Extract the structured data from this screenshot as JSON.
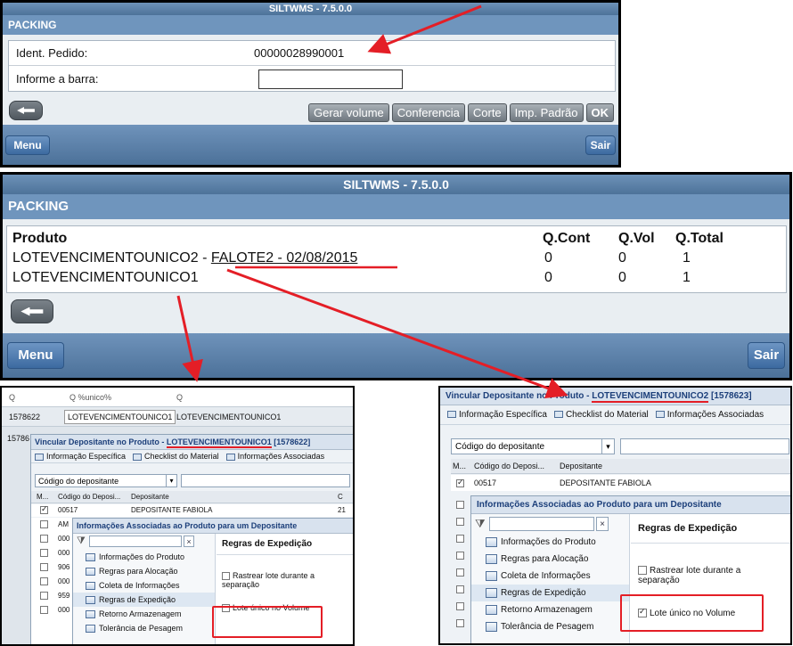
{
  "top": {
    "title": "SILTWMS - 7.5.0.0",
    "section": "PACKING",
    "rows": [
      {
        "label": "Ident. Pedido:",
        "value": "00000028990001"
      },
      {
        "label": "Informe a barra:",
        "value": ""
      }
    ],
    "buttons": [
      "Gerar volume",
      "Conferencia",
      "Corte",
      "Imp. Padrão",
      "OK"
    ],
    "menu": "Menu",
    "sair": "Sair"
  },
  "mid": {
    "title": "SILTWMS - 7.5.0.0",
    "section": "PACKING",
    "columns": [
      "Produto",
      "Q.Cont",
      "Q.Vol",
      "Q.Total"
    ],
    "rows": [
      {
        "produto_a": "LOTEVENCIMENTOUNICO2 - ",
        "produto_b": "FALOTE2 - 02/08/2015",
        "cont": "0",
        "vol": "0",
        "total": "1"
      },
      {
        "produto_a": "LOTEVENCIMENTOUNICO1",
        "produto_b": "",
        "cont": "0",
        "vol": "0",
        "total": "1"
      }
    ],
    "menu": "Menu",
    "sair": "Sair"
  },
  "left": {
    "filter": [
      "Q",
      "Q %unico%",
      "Q"
    ],
    "row1": [
      "1578622",
      "LOTEVENCIMENTOUNICO1",
      "LOTEVENCIMENTOUNICO1"
    ],
    "row2_id": "15786",
    "dialog_title_a": "Vincular Depositante no Produto - ",
    "dialog_title_b": "LOTEVENCIMENTOUNICO1",
    "dialog_title_c": " [1578622]",
    "tabs": [
      "Informação Específica",
      "Checklist do Material",
      "Informações Associadas"
    ],
    "select": "Código do depositante",
    "cols": [
      "M...",
      "Código do Deposi...",
      "Depositante",
      "C"
    ],
    "first_row": [
      "00517",
      "DEPOSITANTE FABIOLA",
      "21"
    ],
    "left_codes": [
      "AM",
      "000",
      "000",
      "906",
      "000",
      "959",
      "000"
    ],
    "inner_title": "Informações Associadas ao Produto para um Depositante",
    "tree": [
      "Informações do Produto",
      "Regras para Alocação",
      "Coleta de Informações",
      "Regras de Expedição",
      "Retorno Armazenagem",
      "Tolerância de Pesagem"
    ],
    "right_title": "Regras de Expedição",
    "opt1": "Rastrear lote durante a separação",
    "opt2": "Lote único no Volume"
  },
  "right": {
    "dialog_title_a": "Vincular Depositante no Produto - ",
    "dialog_title_b": "LOTEVENCIMENTOUNICO2",
    "dialog_title_c": " [1578623]",
    "tabs": [
      "Informação Específica",
      "Checklist do Material",
      "Informações Associadas"
    ],
    "select": "Código do depositante",
    "cols": [
      "M...",
      "Código do Deposi...",
      "Depositante"
    ],
    "first_row": [
      "00517",
      "DEPOSITANTE FABIOLA"
    ],
    "inner_title": "Informações Associadas ao Produto para um Depositante",
    "tree": [
      "Informações do Produto",
      "Regras para Alocação",
      "Coleta de Informações",
      "Regras de Expedição",
      "Retorno Armazenagem",
      "Tolerância de Pesagem"
    ],
    "right_title": "Regras de Expedição",
    "opt1": "Rastrear lote durante a separação",
    "opt2": "Lote único no Volume"
  },
  "colors": {
    "red": "#e41e26",
    "blue_bar": "#6f95bd",
    "link_blue": "#1c3f7a"
  }
}
